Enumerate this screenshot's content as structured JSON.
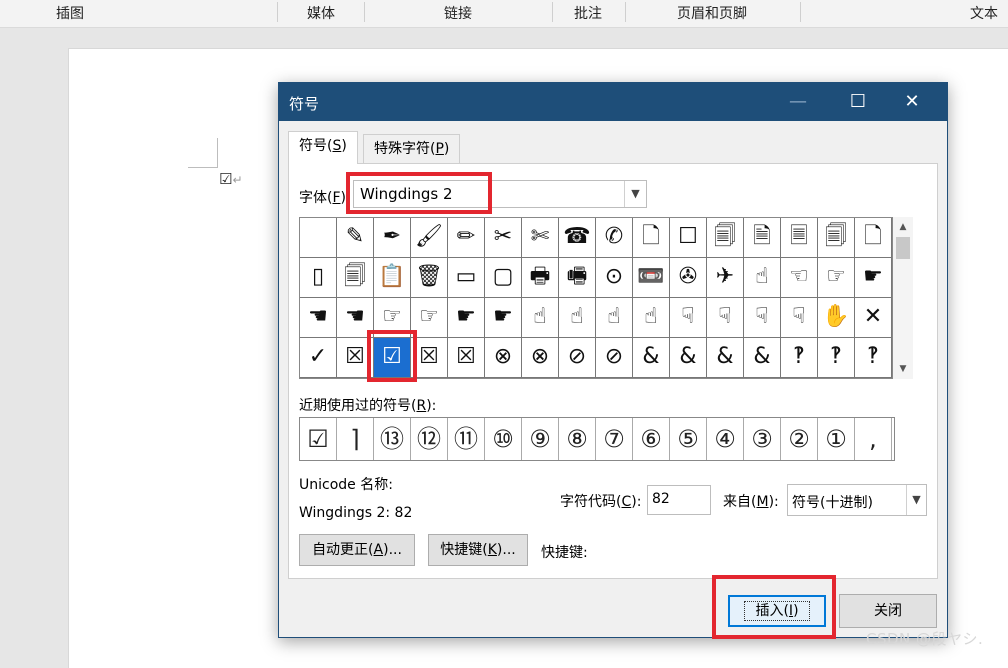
{
  "ribbon": {
    "groups": [
      "插图",
      "媒体",
      "链接",
      "批注",
      "页眉和页脚",
      "文本"
    ]
  },
  "document": {
    "inserted_char": "☑",
    "paragraph_mark": "↵"
  },
  "dialog": {
    "title": "符号",
    "window_buttons": {
      "minimize": "—",
      "maximize": "☐",
      "close": "✕"
    },
    "tabs": [
      {
        "label": "符号(",
        "key": "S",
        "suffix": ")",
        "active": true
      },
      {
        "label": "特殊字符(",
        "key": "P",
        "suffix": ")",
        "active": false
      }
    ],
    "font": {
      "label": "字体(",
      "key": "F",
      "suffix": "):",
      "value": "Wingdings 2"
    },
    "symbol_grid": {
      "rows": [
        [
          " ",
          "✎",
          "✒",
          "🖌",
          "✏",
          "✂",
          "✄",
          "☎",
          "✆",
          "🗋",
          "☐",
          "🗐",
          "🗎",
          "🗏",
          "🗐",
          "🗋"
        ],
        [
          "▯",
          "🗐",
          "📋",
          "🗑",
          "▭",
          "▢",
          "🖶",
          "🖷",
          "⊙",
          "📼",
          "✇",
          "✈",
          "☝",
          "☜",
          "☞",
          "☛"
        ],
        [
          "☚",
          "☚",
          "☞",
          "☞",
          "☛",
          "☛",
          "☝",
          "☝",
          "☝",
          "☝",
          "☟",
          "☟",
          "☟",
          "☟",
          "✋",
          "✕"
        ],
        [
          "✓",
          "☒",
          "☑",
          "☒",
          "☒",
          "⊗",
          "⊗",
          "⊘",
          "⊘",
          "&",
          "&",
          "&",
          "&",
          "‽",
          "‽",
          "‽"
        ]
      ],
      "selected": {
        "row": 3,
        "col": 2
      }
    },
    "recent": {
      "label": "近期使用过的符号(",
      "key": "R",
      "suffix": "):",
      "symbols": [
        "☑",
        "⌉",
        "⑬",
        "⑫",
        "⑪",
        "⑩",
        "⑨",
        "⑧",
        "⑦",
        "⑥",
        "⑤",
        "④",
        "③",
        "②",
        "①",
        ","
      ]
    },
    "unicode_name_label": "Unicode 名称:",
    "char_name": "Wingdings 2: 82",
    "char_code": {
      "label": "字符代码(",
      "key": "C",
      "suffix": "):",
      "value": "82"
    },
    "from": {
      "label": "来自(",
      "key": "M",
      "suffix": "):",
      "value": "符号(十进制)"
    },
    "buttons": {
      "autocorrect": {
        "label": "自动更正(",
        "key": "A",
        "suffix": ")..."
      },
      "shortcut_key": {
        "label": "快捷键(",
        "key": "K",
        "suffix": ")..."
      },
      "shortcut_label": "快捷键:",
      "insert": {
        "label": "插入(",
        "key": "I",
        "suffix": ")"
      },
      "close": "关闭"
    }
  },
  "watermark": "CSDN @段ヤシ.",
  "colors": {
    "titlebar": "#1e4e79",
    "selection": "#1b6ed0",
    "highlight": "#e3262f"
  }
}
